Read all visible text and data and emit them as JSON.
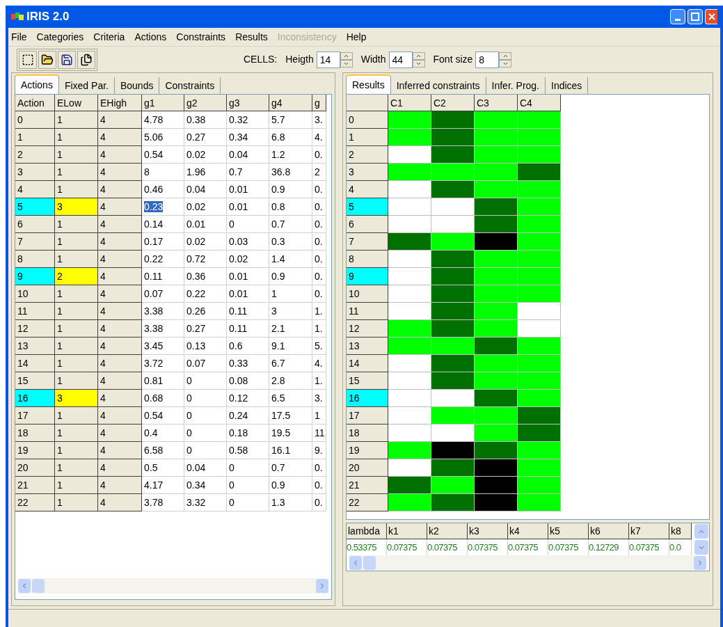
{
  "window": {
    "title": "IRIS 2.0"
  },
  "menu": [
    {
      "label": "File",
      "disabled": false
    },
    {
      "label": "Categories",
      "disabled": false
    },
    {
      "label": "Criteria",
      "disabled": false
    },
    {
      "label": "Actions",
      "disabled": false
    },
    {
      "label": "Constraints",
      "disabled": false
    },
    {
      "label": "Results",
      "disabled": false
    },
    {
      "label": "Inconsistency",
      "disabled": true
    },
    {
      "label": "Help",
      "disabled": false
    }
  ],
  "toolbar": {
    "cells_label": "CELLS:",
    "spinners": [
      {
        "label": "Heigth",
        "value": "14"
      },
      {
        "label": "Width",
        "value": "44"
      },
      {
        "label": "Font size",
        "value": "8"
      }
    ]
  },
  "left_tabs": [
    {
      "label": "Actions",
      "selected": true
    },
    {
      "label": "Fixed Par.",
      "selected": false
    },
    {
      "label": "Bounds",
      "selected": false
    },
    {
      "label": "Constraints",
      "selected": false
    }
  ],
  "actions_table": {
    "columns": [
      "Action",
      "ELow",
      "EHigh",
      "g1",
      "g2",
      "g3",
      "g4",
      "g"
    ],
    "rows": [
      {
        "highlighted": false,
        "selected": false,
        "cells": [
          "0",
          "1",
          "4",
          "4.78",
          "0.38",
          "0.32",
          "5.7",
          "3."
        ]
      },
      {
        "highlighted": false,
        "selected": false,
        "cells": [
          "1",
          "1",
          "4",
          "5.06",
          "0.27",
          "0.34",
          "6.8",
          "4."
        ]
      },
      {
        "highlighted": false,
        "selected": false,
        "cells": [
          "2",
          "1",
          "4",
          "0.54",
          "0.02",
          "0.04",
          "1.2",
          "0."
        ]
      },
      {
        "highlighted": false,
        "selected": false,
        "cells": [
          "3",
          "1",
          "4",
          "8",
          "1.96",
          "0.7",
          "36.8",
          "2"
        ]
      },
      {
        "highlighted": false,
        "selected": false,
        "cells": [
          "4",
          "1",
          "4",
          "0.46",
          "0.04",
          "0.01",
          "0.9",
          "0."
        ]
      },
      {
        "highlighted": true,
        "selected": true,
        "cells": [
          "5",
          "3",
          "4",
          "0.23",
          "0.02",
          "0.01",
          "0.8",
          "0."
        ]
      },
      {
        "highlighted": false,
        "selected": false,
        "cells": [
          "6",
          "1",
          "4",
          "0.14",
          "0.01",
          "0",
          "0.7",
          "0."
        ]
      },
      {
        "highlighted": false,
        "selected": false,
        "cells": [
          "7",
          "1",
          "4",
          "0.17",
          "0.02",
          "0.03",
          "0.3",
          "0."
        ]
      },
      {
        "highlighted": false,
        "selected": false,
        "cells": [
          "8",
          "1",
          "4",
          "0.22",
          "0.72",
          "0.02",
          "1.4",
          "0."
        ]
      },
      {
        "highlighted": true,
        "selected": false,
        "cells": [
          "9",
          "2",
          "4",
          "0.11",
          "0.36",
          "0.01",
          "0.9",
          "0."
        ]
      },
      {
        "highlighted": false,
        "selected": false,
        "cells": [
          "10",
          "1",
          "4",
          "0.07",
          "0.22",
          "0.01",
          "1",
          "0."
        ]
      },
      {
        "highlighted": false,
        "selected": false,
        "cells": [
          "11",
          "1",
          "4",
          "3.38",
          "0.26",
          "0.11",
          "3",
          "1."
        ]
      },
      {
        "highlighted": false,
        "selected": false,
        "cells": [
          "12",
          "1",
          "4",
          "3.38",
          "0.27",
          "0.11",
          "2.1",
          "1."
        ]
      },
      {
        "highlighted": false,
        "selected": false,
        "cells": [
          "13",
          "1",
          "4",
          "3.45",
          "0.13",
          "0.6",
          "9.1",
          "5."
        ]
      },
      {
        "highlighted": false,
        "selected": false,
        "cells": [
          "14",
          "1",
          "4",
          "3.72",
          "0.07",
          "0.33",
          "6.7",
          "4."
        ]
      },
      {
        "highlighted": false,
        "selected": false,
        "cells": [
          "15",
          "1",
          "4",
          "0.81",
          "0",
          "0.08",
          "2.8",
          "1."
        ]
      },
      {
        "highlighted": true,
        "selected": false,
        "cells": [
          "16",
          "3",
          "4",
          "0.68",
          "0",
          "0.12",
          "6.5",
          "3."
        ]
      },
      {
        "highlighted": false,
        "selected": false,
        "cells": [
          "17",
          "1",
          "4",
          "0.54",
          "0",
          "0.24",
          "17.5",
          "1"
        ]
      },
      {
        "highlighted": false,
        "selected": false,
        "cells": [
          "18",
          "1",
          "4",
          "0.4",
          "0",
          "0.18",
          "19.5",
          "11"
        ]
      },
      {
        "highlighted": false,
        "selected": false,
        "cells": [
          "19",
          "1",
          "4",
          "6.58",
          "0",
          "0.58",
          "16.1",
          "9."
        ]
      },
      {
        "highlighted": false,
        "selected": false,
        "cells": [
          "20",
          "1",
          "4",
          "0.5",
          "0.04",
          "0",
          "0.7",
          "0."
        ]
      },
      {
        "highlighted": false,
        "selected": false,
        "cells": [
          "21",
          "1",
          "4",
          "4.17",
          "0.34",
          "0",
          "0.9",
          "0."
        ]
      },
      {
        "highlighted": false,
        "selected": false,
        "cells": [
          "22",
          "1",
          "4",
          "3.78",
          "3.32",
          "0",
          "1.3",
          "0."
        ]
      }
    ]
  },
  "right_tabs": [
    {
      "label": "Results",
      "selected": true
    },
    {
      "label": "Inferred constraints",
      "selected": false
    },
    {
      "label": "Infer. Prog.",
      "selected": false
    },
    {
      "label": "Indices",
      "selected": false
    }
  ],
  "results_table": {
    "columns": [
      "C1",
      "C2",
      "C3",
      "C4"
    ],
    "rows": [
      {
        "label": "0",
        "highlighted": false,
        "cells": [
          {
            "color": "#00ff00"
          },
          {
            "color": "#007000"
          },
          {
            "color": "#00ff00"
          },
          {
            "color": "#00ff00"
          }
        ]
      },
      {
        "label": "1",
        "highlighted": false,
        "cells": [
          {
            "color": "#00ff00"
          },
          {
            "color": "#007000"
          },
          {
            "color": "#00ff00"
          },
          {
            "color": "#00ff00"
          }
        ]
      },
      {
        "label": "2",
        "highlighted": false,
        "cells": [
          {
            "color": "#ffffff"
          },
          {
            "color": "#007000"
          },
          {
            "color": "#00ff00"
          },
          {
            "color": "#00ff00"
          }
        ]
      },
      {
        "label": "3",
        "highlighted": false,
        "cells": [
          {
            "color": "#00ff00"
          },
          {
            "color": "#00ff00"
          },
          {
            "color": "#00ff00"
          },
          {
            "color": "#007000"
          }
        ]
      },
      {
        "label": "4",
        "highlighted": false,
        "cells": [
          {
            "color": "#ffffff"
          },
          {
            "color": "#007000"
          },
          {
            "color": "#00ff00"
          },
          {
            "color": "#00ff00"
          }
        ]
      },
      {
        "label": "5",
        "highlighted": true,
        "cells": [
          {
            "color": "#ffffff"
          },
          {
            "color": "#ffffff"
          },
          {
            "color": "#007000"
          },
          {
            "color": "#00ff00"
          }
        ]
      },
      {
        "label": "6",
        "highlighted": false,
        "cells": [
          {
            "color": "#ffffff"
          },
          {
            "color": "#ffffff"
          },
          {
            "color": "#007000"
          },
          {
            "color": "#00ff00"
          }
        ]
      },
      {
        "label": "7",
        "highlighted": false,
        "cells": [
          {
            "color": "#007000"
          },
          {
            "color": "#00ff00"
          },
          {
            "color": "#000000"
          },
          {
            "color": "#00ff00"
          }
        ]
      },
      {
        "label": "8",
        "highlighted": false,
        "cells": [
          {
            "color": "#ffffff"
          },
          {
            "color": "#007000"
          },
          {
            "color": "#00ff00"
          },
          {
            "color": "#00ff00"
          }
        ]
      },
      {
        "label": "9",
        "highlighted": true,
        "cells": [
          {
            "color": "#ffffff"
          },
          {
            "color": "#007000"
          },
          {
            "color": "#00ff00"
          },
          {
            "color": "#00ff00"
          }
        ]
      },
      {
        "label": "10",
        "highlighted": false,
        "cells": [
          {
            "color": "#ffffff"
          },
          {
            "color": "#007000"
          },
          {
            "color": "#00ff00"
          },
          {
            "color": "#00ff00"
          }
        ]
      },
      {
        "label": "11",
        "highlighted": false,
        "cells": [
          {
            "color": "#ffffff"
          },
          {
            "color": "#007000"
          },
          {
            "color": "#00ff00"
          },
          {
            "color": "#ffffff"
          }
        ]
      },
      {
        "label": "12",
        "highlighted": false,
        "cells": [
          {
            "color": "#00ff00"
          },
          {
            "color": "#007000"
          },
          {
            "color": "#00ff00"
          },
          {
            "color": "#ffffff"
          }
        ]
      },
      {
        "label": "13",
        "highlighted": false,
        "cells": [
          {
            "color": "#00ff00"
          },
          {
            "color": "#00ff00"
          },
          {
            "color": "#007000"
          },
          {
            "color": "#00ff00"
          }
        ]
      },
      {
        "label": "14",
        "highlighted": false,
        "cells": [
          {
            "color": "#ffffff"
          },
          {
            "color": "#007000"
          },
          {
            "color": "#00ff00"
          },
          {
            "color": "#00ff00"
          }
        ]
      },
      {
        "label": "15",
        "highlighted": false,
        "cells": [
          {
            "color": "#ffffff"
          },
          {
            "color": "#007000"
          },
          {
            "color": "#00ff00"
          },
          {
            "color": "#00ff00"
          }
        ]
      },
      {
        "label": "16",
        "highlighted": true,
        "cells": [
          {
            "color": "#ffffff"
          },
          {
            "color": "#ffffff"
          },
          {
            "color": "#007000"
          },
          {
            "color": "#00ff00"
          }
        ]
      },
      {
        "label": "17",
        "highlighted": false,
        "cells": [
          {
            "color": "#ffffff"
          },
          {
            "color": "#00ff00"
          },
          {
            "color": "#00ff00"
          },
          {
            "color": "#007000"
          }
        ]
      },
      {
        "label": "18",
        "highlighted": false,
        "cells": [
          {
            "color": "#ffffff"
          },
          {
            "color": "#ffffff"
          },
          {
            "color": "#00ff00"
          },
          {
            "color": "#007000"
          }
        ]
      },
      {
        "label": "19",
        "highlighted": false,
        "cells": [
          {
            "color": "#00ff00"
          },
          {
            "color": "#000000"
          },
          {
            "color": "#007000"
          },
          {
            "color": "#00ff00"
          }
        ]
      },
      {
        "label": "20",
        "highlighted": false,
        "cells": [
          {
            "color": "#ffffff"
          },
          {
            "color": "#007000"
          },
          {
            "color": "#000000"
          },
          {
            "color": "#00ff00"
          }
        ]
      },
      {
        "label": "21",
        "highlighted": false,
        "cells": [
          {
            "color": "#007000"
          },
          {
            "color": "#00ff00"
          },
          {
            "color": "#000000"
          },
          {
            "color": "#00ff00"
          }
        ]
      },
      {
        "label": "22",
        "highlighted": false,
        "cells": [
          {
            "color": "#00ff00"
          },
          {
            "color": "#007000"
          },
          {
            "color": "#000000"
          },
          {
            "color": "#00ff00"
          }
        ]
      }
    ]
  },
  "parameters_table": {
    "columns": [
      "lambda",
      "k1",
      "k2",
      "k3",
      "k4",
      "k5",
      "k6",
      "k7",
      "k8"
    ],
    "values": [
      "0.53375",
      "0.07375",
      "0.07375",
      "0.07375",
      "0.07375",
      "0.07375",
      "0.12729",
      "0.07375",
      "0.0"
    ]
  }
}
